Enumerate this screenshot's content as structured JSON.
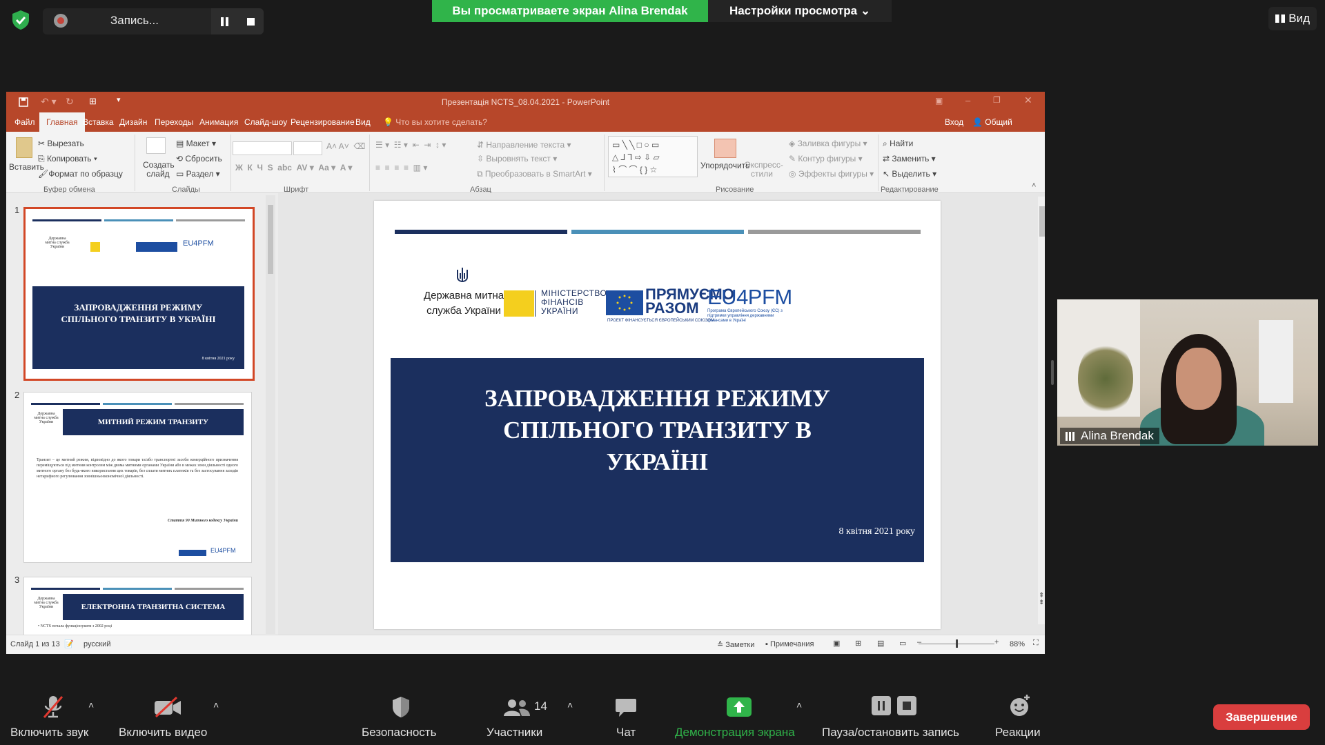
{
  "zoom": {
    "recording_label": "Запись...",
    "share_banner": "Вы просматриваете экран Alina Brendak",
    "view_options": "Настройки просмотра ⌄",
    "view_button": "Вид",
    "participant_name": "Alina Brendak",
    "participants_count": "14",
    "toolbar": {
      "audio": "Включить звук",
      "video": "Включить видео",
      "security": "Безопасность",
      "participants": "Участники",
      "chat": "Чат",
      "share": "Демонстрация экрана",
      "record": "Пауза/остановить запись",
      "reactions": "Реакции",
      "end": "Завершение"
    },
    "colors": {
      "banner": "#30b44a",
      "end": "#d93e3e",
      "share_active": "#30b44a"
    }
  },
  "ppt": {
    "window_title": "Презентація NCTS_08.04.2021 - PowerPoint",
    "tabs": [
      "Файл",
      "Главная",
      "Вставка",
      "Дизайн",
      "Переходы",
      "Анимация",
      "Слайд-шоу",
      "Рецензирование",
      "Вид"
    ],
    "tell_me": "Что вы хотите сделать?",
    "sign_in": "Вход",
    "share": "Общий доступ",
    "ribbon": {
      "paste": "Вставить",
      "cut": "Вырезать",
      "copy": "Копировать",
      "format_painter": "Формат по образцу",
      "clipboard_group": "Буфер обмена",
      "new_slide": "Создать слайд",
      "layout": "Макет",
      "reset": "Сбросить",
      "section": "Раздел",
      "slides_group": "Слайды",
      "font_group": "Шрифт",
      "text_direction": "Направление текста",
      "align_text": "Выровнять текст",
      "smartart": "Преобразовать в SmartArt",
      "paragraph_group": "Абзац",
      "arrange": "Упорядочить",
      "quick_styles": "Экспресс-стили",
      "shape_fill": "Заливка фигуры",
      "shape_outline": "Контур фигуры",
      "shape_effects": "Эффекты фигуры",
      "drawing_group": "Рисование",
      "find": "Найти",
      "replace": "Заменить",
      "select": "Выделить",
      "editing_group": "Редактирование"
    },
    "thumbnails": [
      {
        "num": "1",
        "title": "ЗАПРОВАДЖЕННЯ РЕЖИМУ СПІЛЬНОГО ТРАНЗИТУ В УКРАЇНІ",
        "date": "8 квітня 2021 року"
      },
      {
        "num": "2",
        "title": "МИТНИЙ РЕЖИМ ТРАНЗИТУ",
        "body": "Транзит – це митний режим, відповідно до якого товари та/або транспортні засоби комерційного призначення переміщуються під митним контролем між двома митними органами України або в межах зони діяльності одного митного органу без будь-якого використання цих товарів, без сплати митних платежів та без застосування заходів нетарифного регулювання зовнішньоекономічної діяльності.",
        "source": "Стаття 90 Митного кодексу України"
      },
      {
        "num": "3",
        "title": "ЕЛЕКТРОННА ТРАНЗИТНА СИСТЕМА",
        "bullet": "NCTS почала функціонувати з 2002 році"
      }
    ],
    "slide": {
      "agency": "Державна митна служба України",
      "minfin": "МІНІСТЕРСТВО ФІНАНСІВ УКРАЇНИ",
      "razom": "ПРЯМУЄМО РАЗОМ",
      "razom_sub": "ПРОЕКТ ФІНАНСУЄТЬСЯ ЄВРОПЕЙСЬКИМ СОЮЗОМ",
      "eu4pfm": "EU4PFM",
      "eu4pfm_sub": "Програма Європейського Союзу (ЄС) з підтримки управління державними фінансами в Україні",
      "title": "ЗАПРОВАДЖЕННЯ РЕЖИМУ СПІЛЬНОГО ТРАНЗИТУ В УКРАЇНІ",
      "date": "8 квітня 2021 року",
      "bar_colors": [
        "#1b2f5e",
        "#4a90b8",
        "#9a9a9a"
      ]
    },
    "status": {
      "slide_counter": "Слайд 1 из 13",
      "language": "русский",
      "notes": "Заметки",
      "comments": "Примечания",
      "zoom": "88%"
    }
  }
}
